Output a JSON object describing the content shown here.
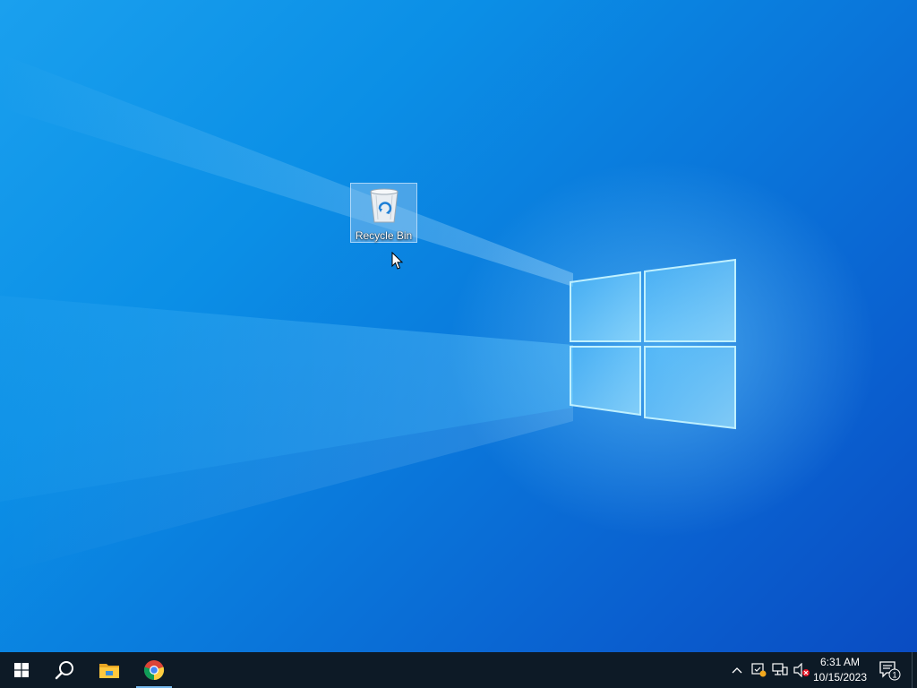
{
  "desktop": {
    "icons": [
      {
        "label": "Recycle Bin",
        "icon": "recycle-bin-icon",
        "selected": true
      }
    ],
    "wallpaper": "windows-10-hero",
    "colors": {
      "accent": "#0a78db",
      "light": "#7fd3ff"
    }
  },
  "taskbar": {
    "start_icon": "windows-logo-icon",
    "search_icon": "search-icon",
    "pinned": [
      {
        "name": "File Explorer",
        "icon": "folder-icon",
        "active": false
      },
      {
        "name": "Google Chrome",
        "icon": "chrome-icon",
        "active": true
      }
    ],
    "tray": {
      "icons": [
        "chevron-up-icon",
        "security-icon",
        "network-icon",
        "volume-muted-icon"
      ]
    },
    "clock": {
      "time": "6:31 AM",
      "date": "10/15/2023"
    },
    "notifications": {
      "icon": "action-center-icon",
      "count": "1"
    },
    "background": "#0d1a26"
  }
}
